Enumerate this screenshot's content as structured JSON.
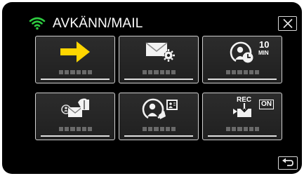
{
  "header": {
    "title": "AVKÄNN/MAIL",
    "wifi_icon": "wifi-icon",
    "close_icon": "close-icon"
  },
  "tiles": [
    {
      "icon": "arrow-right-icon",
      "badge": ""
    },
    {
      "icon": "mail-settings-icon",
      "badge": ""
    },
    {
      "icon": "detection-timer-icon",
      "badge_top": "10",
      "badge_bottom": "MIN"
    },
    {
      "icon": "send-mail-icon",
      "badge": ""
    },
    {
      "icon": "detection-user-icon",
      "badge": ""
    },
    {
      "icon": "rec-download-icon",
      "badge_rec": "REC",
      "badge_on": "ON"
    }
  ],
  "footer": {
    "back_icon": "back-icon"
  },
  "colors": {
    "background": "#000000",
    "wifi": "#2ecc40",
    "arrow": "#ffd600",
    "tile": "#262626",
    "text": "#ffffff"
  }
}
